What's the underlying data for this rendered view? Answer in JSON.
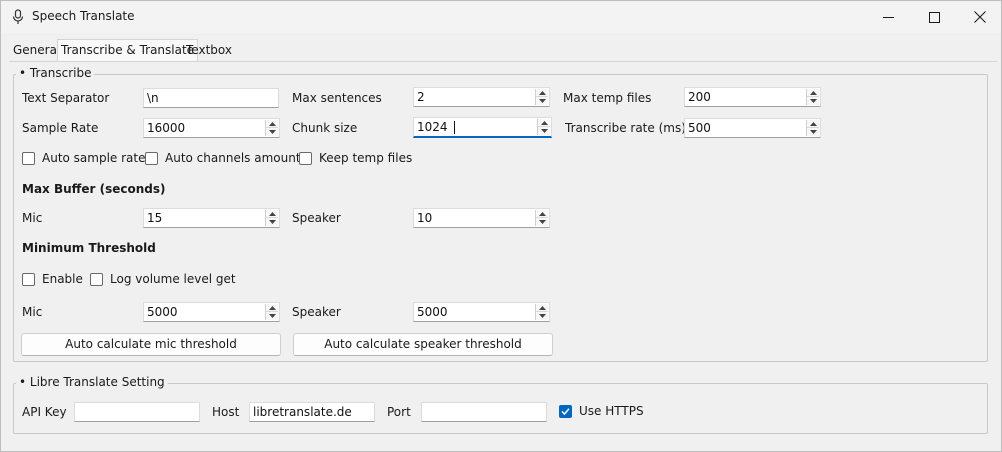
{
  "window": {
    "title": "Speech Translate",
    "icon": "microphone-icon"
  },
  "tabs": [
    {
      "label": "General",
      "active": false
    },
    {
      "label": "Transcribe & Translate",
      "active": true
    },
    {
      "label": "Textbox",
      "active": false
    }
  ],
  "transcribe": {
    "group_title": "Transcribe",
    "text_separator": {
      "label": "Text Separator",
      "value": "\\n"
    },
    "max_sentences": {
      "label": "Max sentences",
      "value": "2"
    },
    "max_temp_files": {
      "label": "Max temp files",
      "value": "200"
    },
    "sample_rate": {
      "label": "Sample Rate",
      "value": "16000"
    },
    "chunk_size": {
      "label": "Chunk size",
      "value": "1024"
    },
    "transcribe_rate": {
      "label": "Transcribe rate (ms)",
      "value": "500"
    },
    "auto_sample_rate": {
      "label": "Auto sample rate",
      "checked": false
    },
    "auto_channels": {
      "label": "Auto channels amount",
      "checked": false
    },
    "keep_temp_files": {
      "label": "Keep temp files",
      "checked": false
    },
    "max_buffer": {
      "heading": "Max Buffer (seconds)",
      "mic": {
        "label": "Mic",
        "value": "15"
      },
      "speaker": {
        "label": "Speaker",
        "value": "10"
      }
    },
    "min_threshold": {
      "heading": "Minimum Threshold",
      "enable": {
        "label": "Enable",
        "checked": false
      },
      "log_volume": {
        "label": "Log volume level get",
        "checked": false
      },
      "mic": {
        "label": "Mic",
        "value": "5000"
      },
      "speaker": {
        "label": "Speaker",
        "value": "5000"
      },
      "auto_mic_button": "Auto calculate mic threshold",
      "auto_speaker_button": "Auto calculate speaker threshold"
    }
  },
  "libre": {
    "group_title": "Libre Translate Setting",
    "api_key": {
      "label": "API Key",
      "value": ""
    },
    "host": {
      "label": "Host",
      "value": "libretranslate.de"
    },
    "port": {
      "label": "Port",
      "value": ""
    },
    "use_https": {
      "label": "Use HTTPS",
      "checked": true
    }
  },
  "colors": {
    "accent": "#0067c0",
    "background": "#f0f0f0"
  }
}
